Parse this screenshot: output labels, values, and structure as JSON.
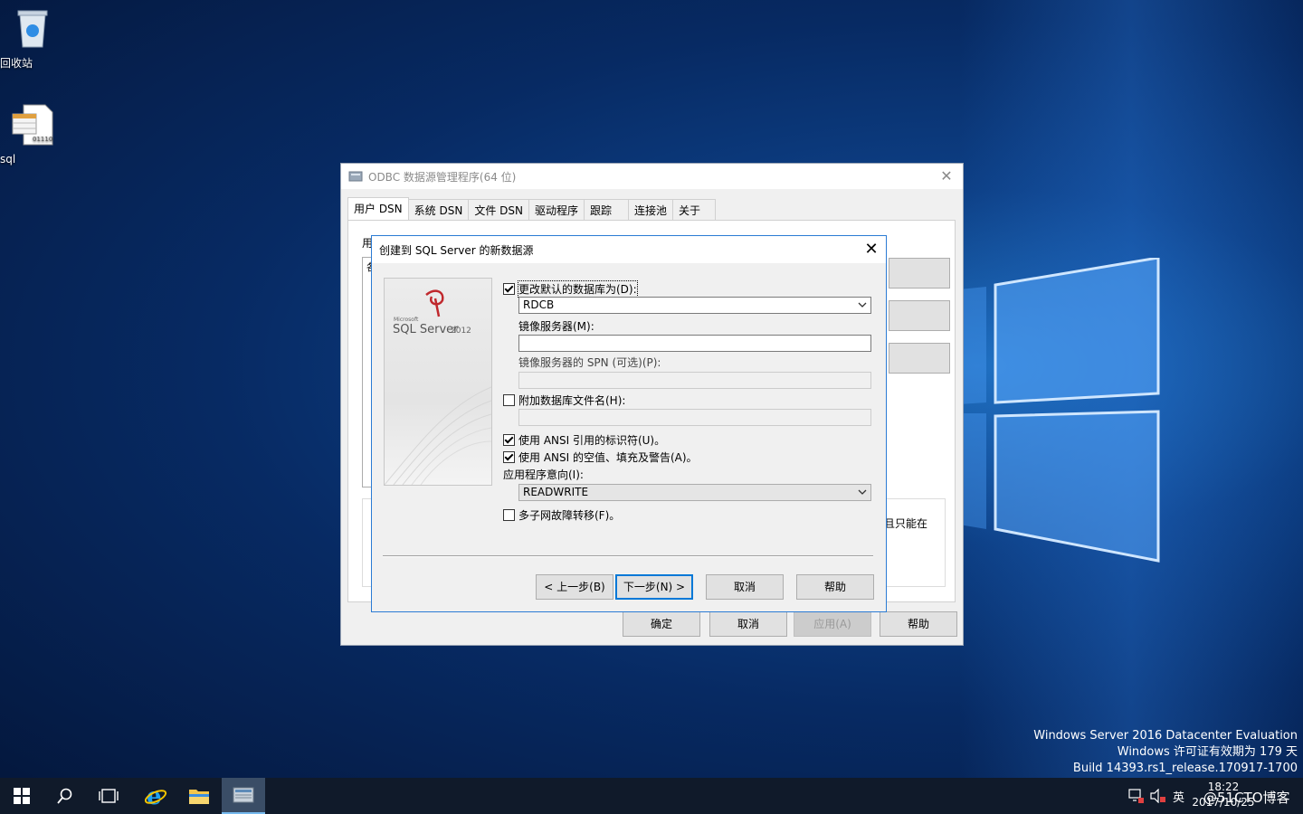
{
  "desktop": {
    "icons": [
      {
        "label": "回收站",
        "icon": "recycle-bin-icon"
      },
      {
        "label": "sql",
        "icon": "data-file-icon"
      }
    ],
    "watermark": [
      "Windows Server 2016 Datacenter Evaluation",
      "Windows 许可证有效期为 179 天",
      "Build 14393.rs1_release.170917-1700"
    ]
  },
  "odbc_window": {
    "title": "ODBC 数据源管理程序(64 位)",
    "tabs": [
      "用户 DSN",
      "系统 DSN",
      "文件 DSN",
      "驱动程序",
      "跟踪",
      "连接池",
      "关于"
    ],
    "active_tab": "用户 DSN",
    "pane_label": "用",
    "pane_box_char": "各",
    "pane_text": "且只能在",
    "buttons": {
      "ok": "确定",
      "cancel": "取消",
      "apply": "应用(A)",
      "help": "帮助"
    }
  },
  "sql_dialog": {
    "title": "创建到 SQL Server 的新数据源",
    "logo_text": "SQL Server",
    "logo_version": "2012",
    "logo_brand": "Microsoft",
    "change_default_db": {
      "label": "更改默认的数据库为(D):",
      "checked": true
    },
    "database_value": "RDCB",
    "mirror_server": {
      "label": "镜像服务器(M):",
      "value": ""
    },
    "mirror_spn": {
      "label": "镜像服务器的 SPN (可选)(P):",
      "value": ""
    },
    "attach_db": {
      "label": "附加数据库文件名(H):",
      "checked": false,
      "value": ""
    },
    "ansi_quoted": {
      "label": "使用 ANSI 引用的标识符(U)。",
      "checked": true
    },
    "ansi_nulls": {
      "label": "使用 ANSI 的空值、填充及警告(A)。",
      "checked": true
    },
    "app_intent": {
      "label": "应用程序意向(I):",
      "value": "READWRITE"
    },
    "multi_subnet": {
      "label": "多子网故障转移(F)。",
      "checked": false
    },
    "buttons": {
      "back": "< 上一步(B)",
      "next": "下一步(N) >",
      "cancel": "取消",
      "help": "帮助"
    }
  },
  "taskbar": {
    "ime": "英",
    "time": "18:22",
    "date": "2017/10/25",
    "overlay": "@51CTO博客"
  }
}
